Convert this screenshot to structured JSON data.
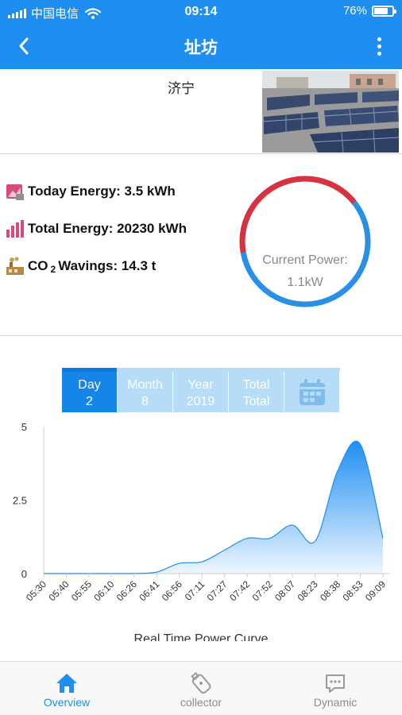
{
  "status_bar": {
    "carrier": "中国电信",
    "time": "09:14",
    "battery": "76%",
    "battery_level": 0.76
  },
  "nav": {
    "title": "址坊"
  },
  "station": {
    "name": "济宁"
  },
  "stats": {
    "today_energy": "Today Energy: 3.5 kWh",
    "total_energy": "Total Energy: 20230 kWh",
    "co2_prefix": "CO",
    "co2_sub": "2",
    "co2_suffix": "Wavings: 14.3 t"
  },
  "gauge": {
    "label": "Current Power:",
    "value": "1.1kW",
    "red_fraction": 0.42,
    "colors": {
      "red": "#d9313f",
      "blue": "#2a8fe6"
    }
  },
  "tabs": [
    {
      "line1": "Day",
      "line2": "2",
      "active": true
    },
    {
      "line1": "Month",
      "line2": "8",
      "active": false
    },
    {
      "line1": "Year",
      "line2": "2019",
      "active": false
    },
    {
      "line1": "Total",
      "line2": "Total",
      "active": false
    }
  ],
  "chart_data": {
    "type": "area",
    "title": "Real Time Power Curve",
    "x": [
      "05:30",
      "05:40",
      "05:55",
      "06:10",
      "06:26",
      "06:41",
      "06:56",
      "07:11",
      "07:27",
      "07:42",
      "07:52",
      "08:07",
      "08:23",
      "08:38",
      "08:53",
      "09:09"
    ],
    "values": [
      0,
      0,
      0,
      0,
      0,
      0.05,
      0.35,
      0.4,
      0.8,
      1.2,
      1.2,
      1.65,
      1.1,
      3.5,
      4.4,
      1.2
    ],
    "ylim": [
      0,
      5
    ],
    "yticks": [
      "0",
      "2.5",
      "5"
    ],
    "color": "#1f8ef1"
  },
  "tabbar": [
    {
      "label": "Overview",
      "icon": "home-icon",
      "active": true
    },
    {
      "label": "collector",
      "icon": "collector-icon",
      "active": false
    },
    {
      "label": "Dynamic",
      "icon": "chat-icon",
      "active": false
    }
  ]
}
